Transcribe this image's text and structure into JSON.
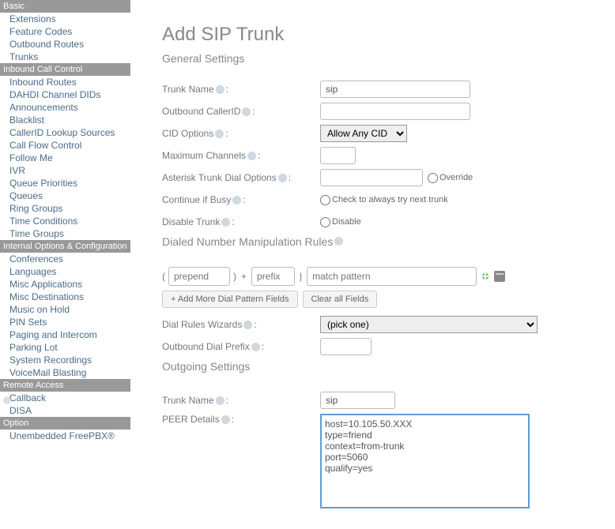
{
  "nav": {
    "sections": [
      {
        "header": "Basic",
        "items": [
          "Extensions",
          "Feature Codes",
          "Outbound Routes",
          "Trunks"
        ]
      },
      {
        "header": "Inbound Call Control",
        "items": [
          "Inbound Routes",
          "DAHDI Channel DIDs",
          "Announcements",
          "Blacklist",
          "CallerID Lookup Sources",
          "Call Flow Control",
          "Follow Me",
          "IVR",
          "Queue Priorities",
          "Queues",
          "Ring Groups",
          "Time Conditions",
          "Time Groups"
        ]
      },
      {
        "header": "Internal Options & Configuration",
        "items": [
          "Conferences",
          "Languages",
          "Misc Applications",
          "Misc Destinations",
          "Music on Hold",
          "PIN Sets",
          "Paging and Intercom",
          "Parking Lot",
          "System Recordings",
          "VoiceMail Blasting"
        ]
      },
      {
        "header": "Remote Access",
        "items": [
          "Callback",
          "DISA"
        ]
      },
      {
        "header": "Option",
        "items": [
          "Unembedded FreePBX®"
        ]
      }
    ]
  },
  "page": {
    "title": "Add SIP Trunk",
    "section_general": "General Settings",
    "section_outgoing": "Outgoing Settings",
    "section_dnmr": "Dialed Number Manipulation Rules"
  },
  "labels": {
    "trunk_name": "Trunk Name",
    "outbound_cid": "Outbound CallerID",
    "cid_options": "CID Options",
    "max_channels": "Maximum Channels",
    "asterisk_dial": "Asterisk Trunk Dial Options",
    "continue_busy": "Continue if Busy",
    "disable_trunk": "Disable Trunk",
    "dial_rules_wizards": "Dial Rules Wizards",
    "outbound_dial_prefix": "Outbound Dial Prefix",
    "peer_details": "PEER Details",
    "override": "Override",
    "check_try_next": "Check to always try next trunk",
    "disable": "Disable"
  },
  "values": {
    "trunk_name": "sip",
    "outbound_cid": "",
    "cid_options": "Allow Any CID",
    "max_channels": "",
    "asterisk_dial": "",
    "dial_rules_wizard": "(pick one)",
    "outbound_dial_prefix": "",
    "outgoing_trunk_name": "sip",
    "peer_details": "host=10.105.50.XXX\ntype=friend\ncontext=from-trunk\nport=5060\nqualify=yes"
  },
  "placeholders": {
    "prepend": "prepend",
    "prefix": "prefix",
    "match": "match pattern"
  },
  "buttons": {
    "add_more": "+ Add More Dial Pattern Fields",
    "clear_all": "Clear all Fields"
  }
}
